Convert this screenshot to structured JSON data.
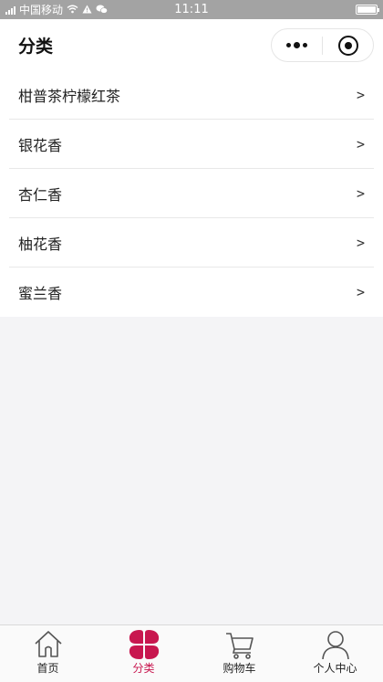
{
  "status_bar": {
    "carrier": "中国移动",
    "time": "11:11",
    "battery_level": 1.0
  },
  "nav": {
    "title": "分类",
    "more_icon": "more-dots-icon",
    "close_icon": "target-icon"
  },
  "categories": [
    {
      "label": "柑普茶柠檬红茶",
      "chevron": ">"
    },
    {
      "label": "银花香",
      "chevron": ">"
    },
    {
      "label": "杏仁香",
      "chevron": ">"
    },
    {
      "label": "柚花香",
      "chevron": ">"
    },
    {
      "label": "蜜兰香",
      "chevron": ">"
    }
  ],
  "tab_bar": {
    "active_color": "#c8174f",
    "tabs": [
      {
        "label": "首页",
        "icon": "home-icon",
        "active": false
      },
      {
        "label": "分类",
        "icon": "category-icon",
        "active": true
      },
      {
        "label": "购物车",
        "icon": "cart-icon",
        "active": false
      },
      {
        "label": "个人中心",
        "icon": "user-icon",
        "active": false
      }
    ]
  }
}
